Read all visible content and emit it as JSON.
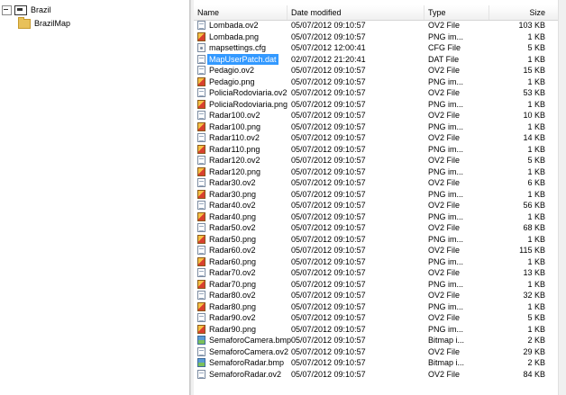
{
  "tree": {
    "root": {
      "label": "Brazil",
      "icon": "drive-icon"
    },
    "child": {
      "label": "BrazilMap",
      "icon": "folder-icon"
    }
  },
  "columns": {
    "name": "Name",
    "date": "Date modified",
    "type": "Type",
    "size": "Size"
  },
  "files": [
    {
      "name": "Lombada.ov2",
      "date": "05/07/2012 09:10:57",
      "type": "OV2 File",
      "size": "103 KB",
      "icon": "doc"
    },
    {
      "name": "Lombada.png",
      "date": "05/07/2012 09:10:57",
      "type": "PNG im...",
      "size": "1 KB",
      "icon": "img"
    },
    {
      "name": "mapsettings.cfg",
      "date": "05/07/2012 12:00:41",
      "type": "CFG File",
      "size": "5 KB",
      "icon": "cfg"
    },
    {
      "name": "MapUserPatch.dat",
      "date": "02/07/2012 21:20:41",
      "type": "DAT File",
      "size": "1 KB",
      "icon": "doc",
      "selected": true
    },
    {
      "name": "Pedagio.ov2",
      "date": "05/07/2012 09:10:57",
      "type": "OV2 File",
      "size": "15 KB",
      "icon": "doc"
    },
    {
      "name": "Pedagio.png",
      "date": "05/07/2012 09:10:57",
      "type": "PNG im...",
      "size": "1 KB",
      "icon": "img"
    },
    {
      "name": "PoliciaRodoviaria.ov2",
      "date": "05/07/2012 09:10:57",
      "type": "OV2 File",
      "size": "53 KB",
      "icon": "doc"
    },
    {
      "name": "PoliciaRodoviaria.png",
      "date": "05/07/2012 09:10:57",
      "type": "PNG im...",
      "size": "1 KB",
      "icon": "img"
    },
    {
      "name": "Radar100.ov2",
      "date": "05/07/2012 09:10:57",
      "type": "OV2 File",
      "size": "10 KB",
      "icon": "doc"
    },
    {
      "name": "Radar100.png",
      "date": "05/07/2012 09:10:57",
      "type": "PNG im...",
      "size": "1 KB",
      "icon": "img"
    },
    {
      "name": "Radar110.ov2",
      "date": "05/07/2012 09:10:57",
      "type": "OV2 File",
      "size": "14 KB",
      "icon": "doc"
    },
    {
      "name": "Radar110.png",
      "date": "05/07/2012 09:10:57",
      "type": "PNG im...",
      "size": "1 KB",
      "icon": "img"
    },
    {
      "name": "Radar120.ov2",
      "date": "05/07/2012 09:10:57",
      "type": "OV2 File",
      "size": "5 KB",
      "icon": "doc"
    },
    {
      "name": "Radar120.png",
      "date": "05/07/2012 09:10:57",
      "type": "PNG im...",
      "size": "1 KB",
      "icon": "img"
    },
    {
      "name": "Radar30.ov2",
      "date": "05/07/2012 09:10:57",
      "type": "OV2 File",
      "size": "6 KB",
      "icon": "doc"
    },
    {
      "name": "Radar30.png",
      "date": "05/07/2012 09:10:57",
      "type": "PNG im...",
      "size": "1 KB",
      "icon": "img"
    },
    {
      "name": "Radar40.ov2",
      "date": "05/07/2012 09:10:57",
      "type": "OV2 File",
      "size": "56 KB",
      "icon": "doc"
    },
    {
      "name": "Radar40.png",
      "date": "05/07/2012 09:10:57",
      "type": "PNG im...",
      "size": "1 KB",
      "icon": "img"
    },
    {
      "name": "Radar50.ov2",
      "date": "05/07/2012 09:10:57",
      "type": "OV2 File",
      "size": "68 KB",
      "icon": "doc"
    },
    {
      "name": "Radar50.png",
      "date": "05/07/2012 09:10:57",
      "type": "PNG im...",
      "size": "1 KB",
      "icon": "img"
    },
    {
      "name": "Radar60.ov2",
      "date": "05/07/2012 09:10:57",
      "type": "OV2 File",
      "size": "115 KB",
      "icon": "doc"
    },
    {
      "name": "Radar60.png",
      "date": "05/07/2012 09:10:57",
      "type": "PNG im...",
      "size": "1 KB",
      "icon": "img"
    },
    {
      "name": "Radar70.ov2",
      "date": "05/07/2012 09:10:57",
      "type": "OV2 File",
      "size": "13 KB",
      "icon": "doc"
    },
    {
      "name": "Radar70.png",
      "date": "05/07/2012 09:10:57",
      "type": "PNG im...",
      "size": "1 KB",
      "icon": "img"
    },
    {
      "name": "Radar80.ov2",
      "date": "05/07/2012 09:10:57",
      "type": "OV2 File",
      "size": "32 KB",
      "icon": "doc"
    },
    {
      "name": "Radar80.png",
      "date": "05/07/2012 09:10:57",
      "type": "PNG im...",
      "size": "1 KB",
      "icon": "img"
    },
    {
      "name": "Radar90.ov2",
      "date": "05/07/2012 09:10:57",
      "type": "OV2 File",
      "size": "5 KB",
      "icon": "doc"
    },
    {
      "name": "Radar90.png",
      "date": "05/07/2012 09:10:57",
      "type": "PNG im...",
      "size": "1 KB",
      "icon": "img"
    },
    {
      "name": "SemaforoCamera.bmp",
      "date": "05/07/2012 09:10:57",
      "type": "Bitmap i...",
      "size": "2 KB",
      "icon": "bmp"
    },
    {
      "name": "SemaforoCamera.ov2",
      "date": "05/07/2012 09:10:57",
      "type": "OV2 File",
      "size": "29 KB",
      "icon": "doc"
    },
    {
      "name": "SemaforoRadar.bmp",
      "date": "05/07/2012 09:10:57",
      "type": "Bitmap i...",
      "size": "2 KB",
      "icon": "bmp"
    },
    {
      "name": "SemaforoRadar.ov2",
      "date": "05/07/2012 09:10:57",
      "type": "OV2 File",
      "size": "84 KB",
      "icon": "doc"
    }
  ],
  "colors": {
    "selection": "#3399ff",
    "folder": "#e8c15a"
  }
}
